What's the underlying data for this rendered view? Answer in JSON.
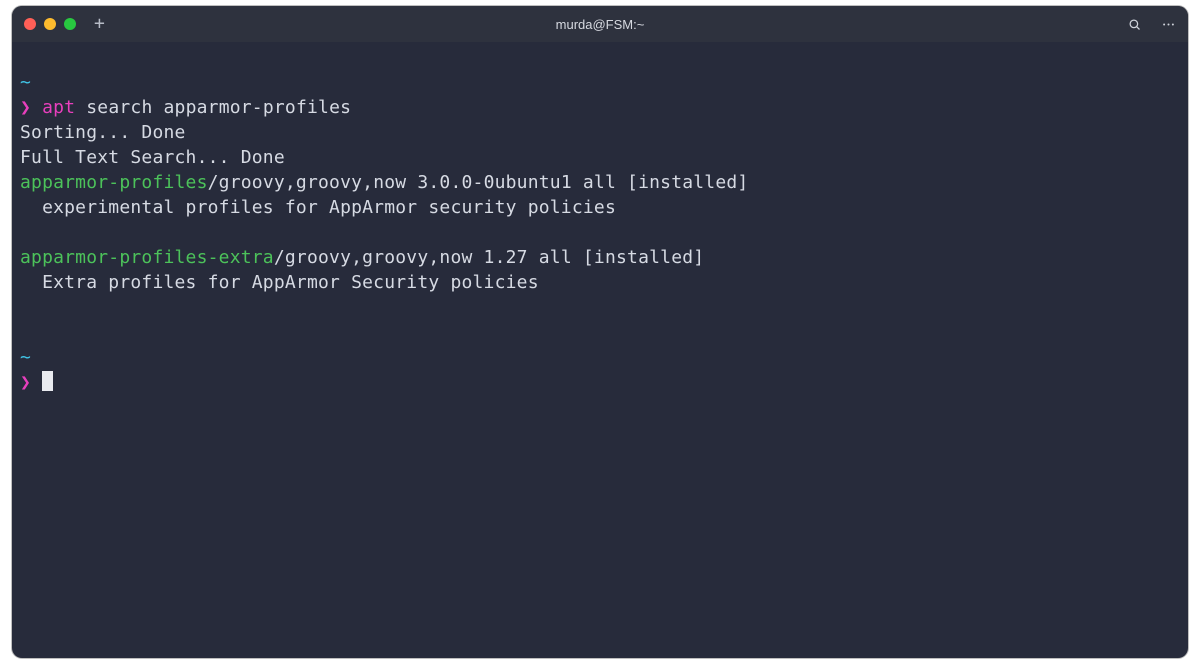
{
  "window": {
    "title": "murda@FSM:~"
  },
  "terminal": {
    "tilde": "~",
    "prompt_glyph": "❯",
    "command": {
      "keyword": "apt",
      "rest": " search apparmor-profiles"
    },
    "sorting_line": "Sorting... Done",
    "fulltext_line": "Full Text Search... Done",
    "results": [
      {
        "name": "apparmor-profiles",
        "meta": "/groovy,groovy,now 3.0.0-0ubuntu1 all [installed]",
        "desc": "  experimental profiles for AppArmor security policies"
      },
      {
        "name": "apparmor-profiles-extra",
        "meta": "/groovy,groovy,now 1.27 all [installed]",
        "desc": "  Extra profiles for AppArmor Security policies"
      }
    ]
  }
}
